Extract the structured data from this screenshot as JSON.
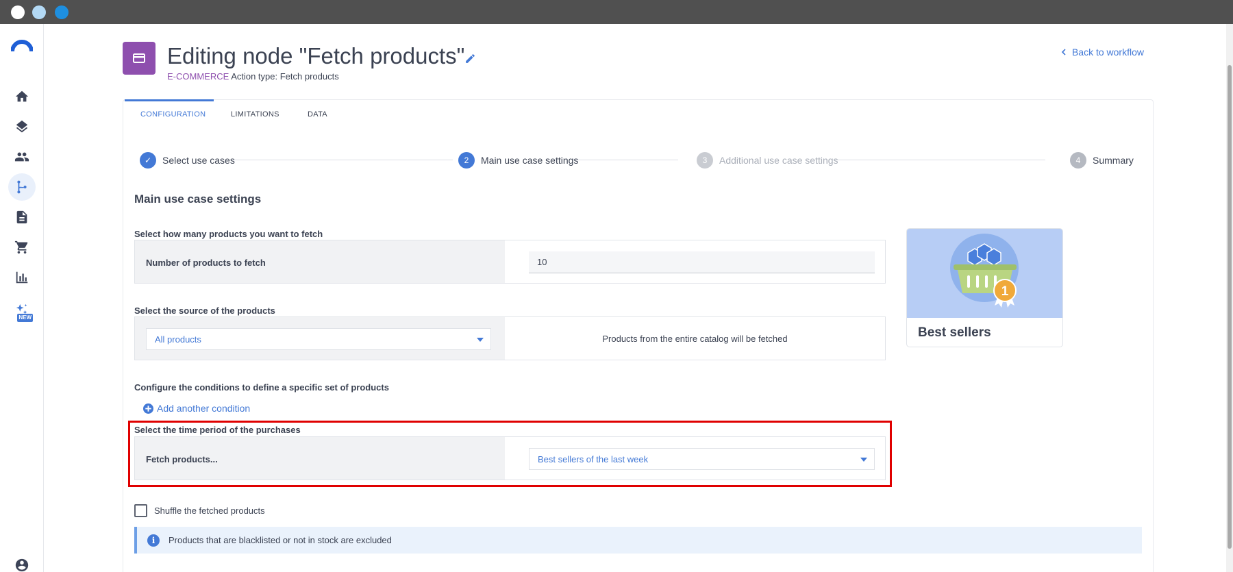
{
  "window": {
    "controls": [
      "close",
      "minimize",
      "maximize"
    ]
  },
  "sidebar": {
    "items": [
      {
        "icon": "home-icon",
        "active": false
      },
      {
        "icon": "layers-icon",
        "active": false
      },
      {
        "icon": "people-icon",
        "active": false
      },
      {
        "icon": "workflow-icon",
        "active": true
      },
      {
        "icon": "document-icon",
        "active": false
      },
      {
        "icon": "cart-icon",
        "active": false
      },
      {
        "icon": "chart-icon",
        "active": false
      },
      {
        "icon": "sparkles-icon",
        "active": false,
        "badge": "NEW"
      }
    ],
    "bottom_icon": "account-icon"
  },
  "header": {
    "title": "Editing node \"Fetch products\"",
    "category": "E-COMMERCE",
    "action_type": "Action type: Fetch products",
    "back_link": "Back to workflow"
  },
  "tabs": [
    {
      "label": "CONFIGURATION",
      "active": true
    },
    {
      "label": "LIMITATIONS",
      "active": false
    },
    {
      "label": "DATA",
      "active": false
    }
  ],
  "stepper": [
    {
      "number": "✓",
      "label": "Select use cases",
      "state": "done"
    },
    {
      "number": "2",
      "label": "Main use case settings",
      "state": "current"
    },
    {
      "number": "3",
      "label": "Additional use case settings",
      "state": "upcoming"
    },
    {
      "number": "4",
      "label": "Summary",
      "state": "upcoming"
    }
  ],
  "main": {
    "section_title": "Main use case settings",
    "count": {
      "label": "Select how many products you want to fetch",
      "row_label": "Number of products to fetch",
      "value": "10"
    },
    "source": {
      "label": "Select the source of the products",
      "selected": "All products",
      "description": "Products from the entire catalog will be fetched"
    },
    "conditions": {
      "label": "Configure the conditions to define a specific set of products",
      "add_label": "Add another condition"
    },
    "period": {
      "label": "Select the time period of the purchases",
      "row_label": "Fetch products...",
      "selected": "Best sellers of the last week"
    },
    "shuffle_label": "Shuffle the fetched products",
    "shuffle_checked": false,
    "info_text": "Products that are blacklisted or not in stock are excluded"
  },
  "tile": {
    "title": "Best sellers",
    "badge_number": "1"
  },
  "colors": {
    "accent": "#4379d6",
    "category": "#8e4fae",
    "highlight": "#e00000"
  }
}
